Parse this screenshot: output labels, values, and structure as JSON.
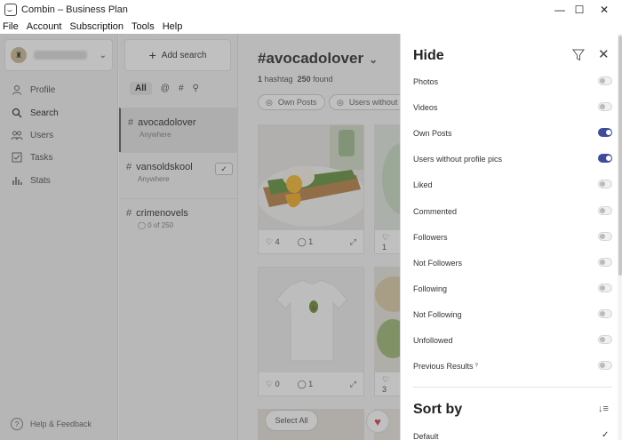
{
  "window": {
    "title": "Combin – Business Plan",
    "minimize": "—",
    "maximize": "☐",
    "close": "✕"
  },
  "menu": [
    "File",
    "Account",
    "Subscription",
    "Tools",
    "Help"
  ],
  "sidebar": {
    "account_chevron": "⌄",
    "nav": [
      {
        "label": "Profile",
        "icon": "user-icon"
      },
      {
        "label": "Search",
        "icon": "search-icon",
        "active": true
      },
      {
        "label": "Users",
        "icon": "users-icon"
      },
      {
        "label": "Tasks",
        "icon": "checklist-icon"
      },
      {
        "label": "Stats",
        "icon": "bar-chart-icon"
      }
    ],
    "help": "Help & Feedback"
  },
  "search_column": {
    "add_label": "Add search",
    "filters": {
      "all": "All",
      "mention": "@",
      "hash": "#",
      "location": "⚲"
    },
    "items": [
      {
        "name": "avocadolover",
        "sub": "Anywhere",
        "active": true
      },
      {
        "name": "vansoldskool",
        "sub": "Anywhere",
        "check": "✓"
      },
      {
        "name": "crimenovels",
        "sub": "◯  0 of 250"
      }
    ]
  },
  "content": {
    "title": "#avocadolover",
    "title_chevron": "⌄",
    "meta": {
      "hashtags": "1",
      "hashtag_label": "hashtag",
      "found": "250",
      "found_label": "found"
    },
    "chips": [
      "Own Posts",
      "Users without profile pics"
    ],
    "cards": [
      {
        "likes": "4",
        "comments": "1"
      },
      {
        "likes": "1",
        "comments": ""
      },
      {
        "likes": "0",
        "comments": "1"
      },
      {
        "likes": "3",
        "comments": ""
      }
    ],
    "select_all": "Select All",
    "heart": "♥"
  },
  "panel": {
    "title": "Hide",
    "close": "✕",
    "options": [
      {
        "label": "Photos",
        "on": false
      },
      {
        "label": "Videos",
        "on": false
      },
      {
        "label": "Own Posts",
        "on": true
      },
      {
        "label": "Users without profile pics",
        "on": true
      },
      {
        "label": "Liked",
        "on": false
      },
      {
        "label": "Commented",
        "on": false
      },
      {
        "label": "Followers",
        "on": false
      },
      {
        "label": "Not Followers",
        "on": false
      },
      {
        "label": "Following",
        "on": false
      },
      {
        "label": "Not Following",
        "on": false
      },
      {
        "label": "Unfollowed",
        "on": false
      },
      {
        "label": "Previous Results",
        "on": false,
        "sup": "?"
      }
    ],
    "sort_title": "Sort by",
    "sort_icon": "↓≡",
    "sort_default": "Default",
    "sort_check": "✓",
    "accent": "#3f4c9c"
  }
}
